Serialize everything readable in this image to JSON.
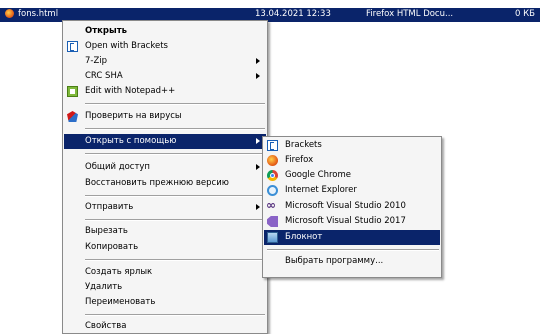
{
  "file_row": {
    "name": "fons.html",
    "date": "13.04.2021 12:33",
    "type": "Firefox HTML Docu...",
    "size": "0 КБ"
  },
  "context_menu": {
    "open": "Открыть",
    "open_with_brackets": "Open with Brackets",
    "seven_zip": "7-Zip",
    "crc_sha": "CRC SHA",
    "edit_notepadpp": "Edit with Notepad++",
    "check_viruses": "Проверить на вирусы",
    "open_with": "Открыть с помощью",
    "sharing": "Общий доступ",
    "restore_previous": "Восстановить прежнюю версию",
    "send_to": "Отправить",
    "cut": "Вырезать",
    "copy": "Копировать",
    "create_shortcut": "Создать ярлык",
    "delete": "Удалить",
    "rename": "Переименовать",
    "properties": "Свойства"
  },
  "submenu": {
    "brackets": "Brackets",
    "firefox": "Firefox",
    "chrome": "Google Chrome",
    "ie": "Internet Explorer",
    "vs2010": "Microsoft Visual Studio 2010",
    "vs2017": "Microsoft Visual Studio 2017",
    "notepad": "Блокнот",
    "choose_program": "Выбрать программу..."
  },
  "colors": {
    "selection": "#0a246a",
    "menu_background": "#f5f5f5"
  }
}
